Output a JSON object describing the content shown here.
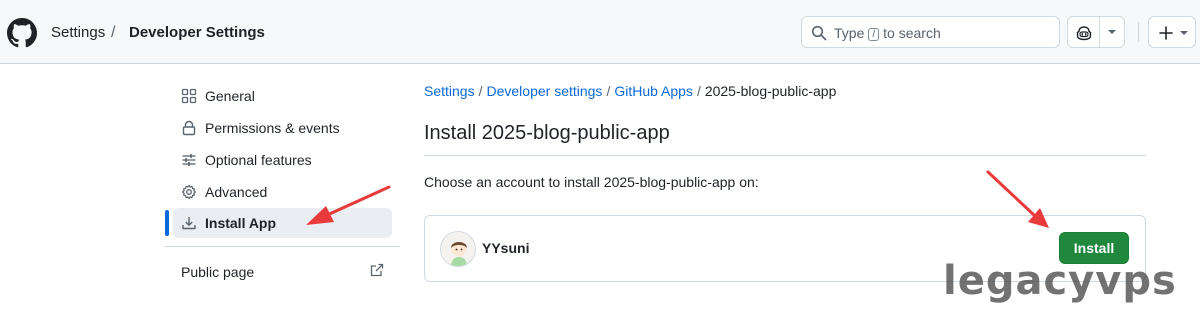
{
  "header": {
    "breadcrumb": {
      "settings": "Settings",
      "separator": "/",
      "developer_settings": "Developer Settings"
    },
    "search": {
      "prefix": "Type",
      "key": "/",
      "suffix": "to search"
    },
    "icons": {
      "logo": "github-logo-icon",
      "search": "search-icon",
      "copilot": "copilot-icon",
      "plus": "plus-icon"
    }
  },
  "sidebar": {
    "items": [
      {
        "label": "General",
        "icon": "apps-grid-icon",
        "active": false
      },
      {
        "label": "Permissions & events",
        "icon": "lock-icon",
        "active": false
      },
      {
        "label": "Optional features",
        "icon": "sliders-icon",
        "active": false
      },
      {
        "label": "Advanced",
        "icon": "gear-icon",
        "active": false
      },
      {
        "label": "Install App",
        "icon": "download-icon",
        "active": true
      }
    ],
    "public_page": {
      "label": "Public page",
      "icon": "link-external-icon"
    }
  },
  "main": {
    "breadcrumb": [
      {
        "label": "Settings",
        "link": true
      },
      {
        "label": "Developer settings",
        "link": true
      },
      {
        "label": "GitHub Apps",
        "link": true
      },
      {
        "label": "2025-blog-public-app",
        "link": false
      }
    ],
    "title": "Install 2025-blog-public-app",
    "prompt": "Choose an account to install 2025-blog-public-app on:",
    "account": {
      "name": "YYsuni",
      "install_label": "Install"
    }
  },
  "watermark": "legacyvps",
  "colors": {
    "accent": "#0969da",
    "install_green": "#1f883d",
    "annotation_red": "#e83a3a",
    "header_bg": "#f6f8fa"
  }
}
